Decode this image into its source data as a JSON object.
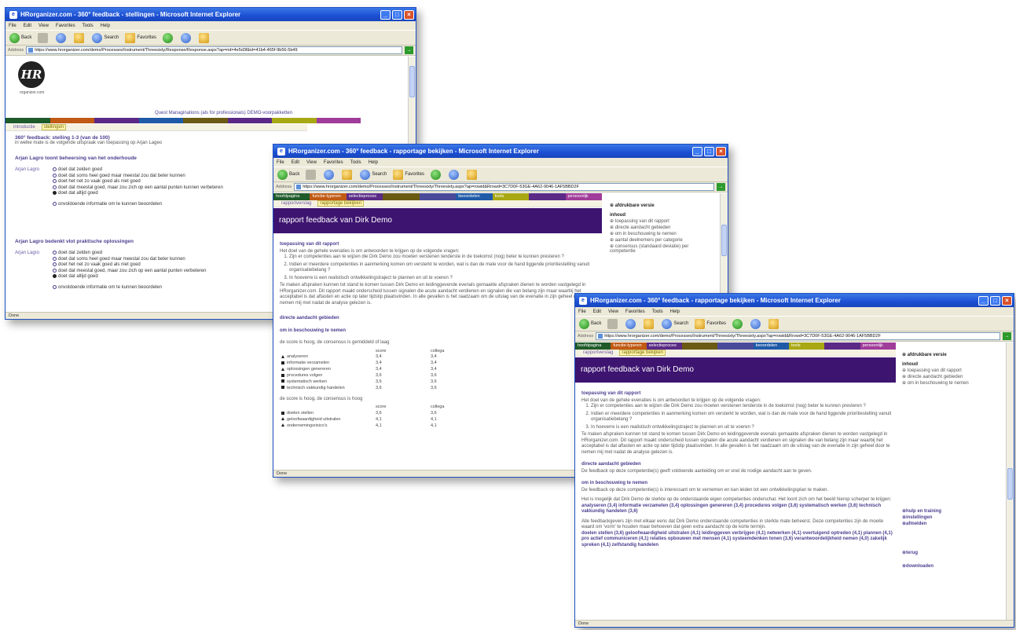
{
  "browser": {
    "menu": [
      "File",
      "Edit",
      "View",
      "Favorites",
      "Tools",
      "Help"
    ],
    "toolbar": {
      "back": "Back",
      "search": "Search",
      "favorites": "Favorites"
    },
    "address_label": "Address",
    "go_label": "Go",
    "status": "Done"
  },
  "window1": {
    "title": "HRorganizer.com - 360° feedback - stellingen - Microsoft Internet Explorer",
    "url": "https://www.hrorganizer.com/demo/Processes/Instrument/Threesixty/Response/Response.aspx?ap=rid=4e5d3f&id=41b4-465f-9b56-5b49",
    "logo_text": "HR",
    "logo_sub": "organizer.com",
    "tagline": "Quest Managinations (als for professionals) DEMO-voorpakketten",
    "colors": [
      "#1f5a2a",
      "#c05a14",
      "#5a2a86",
      "#1f5aa8",
      "#6b5a14",
      "#5a2a86",
      "#a8a814",
      "#a03c9a"
    ],
    "subtabs": [
      "introductie",
      "stellingen"
    ],
    "title_line": "360° feedback: stelling 1-3 (van de 100)",
    "subtitle_line": "in welke mate is de volgende uitspraak van toepassing op Arjan Lageo",
    "blocks": [
      {
        "heading": "Arjan Lagro toont beheersing van het onderhoude",
        "who": "Arjan Lagro",
        "options": [
          "doet dat zelden goed",
          "doet dat soms heel goed maar meestal zou dat beter kunnen",
          "doet het net zo vaak goed als niet goed",
          "doet dat meestal goed, maar zou zich op een aantal punten kunnen verbeteren",
          "doet dat altijd goed"
        ],
        "selected": 4,
        "more": "onvoldoende informatie om te kunnen beoordelen"
      },
      {
        "heading": "Arjan Lagro bedenkt vlot praktische oplossingen",
        "who": "Arjan Lagro",
        "options": [
          "doet dat zelden goed",
          "doet dat soms heel goed maar meestal zou dat beter kunnen",
          "doet het net zo vaak goed als niet goed",
          "doet dat meestal goed, maar zou zich op een aantal punten verbeteren",
          "doet dat altijd goed"
        ],
        "selected": 4,
        "more": "onvoldoende informatie om te kunnen beoordelen"
      }
    ]
  },
  "window2": {
    "title": "HRorganizer.com - 360° feedback - rapportage bekijken - Microsoft Internet Explorer",
    "url": "https://www.hrorganizer.com/demo/Processes/Instrument/Threesixty/Threesixty.aspx?ap=rowid&Rrowd=3C7D0F-53GE-4A62-9046-1AF5BBD2F",
    "navtabs": [
      "hoofdpagina",
      "functie-typeren",
      "selectieproces",
      "",
      "",
      "beoordelen",
      "tools",
      "",
      "persoonlijk"
    ],
    "navcolors": [
      "#1f5a2a",
      "#c05a14",
      "#5a2a86",
      "#6b5a14",
      "#4a4a9a",
      "#1f5aa8",
      "#a8a814",
      "#5a2a86",
      "#a03c9a"
    ],
    "subtabs": [
      "rapportverslag",
      "rapportage bekijken"
    ],
    "banner": "rapport feedback van Dirk Demo",
    "side_title": "afdrukbare versie",
    "side_heading": "inhoud",
    "side_items": [
      "toepassing van dit rapport",
      "directe aandacht gebieden",
      "om in beschouwing te nemen",
      "aantal deelnemers per categorie",
      "consensus (standaard deviatie) per competentie"
    ],
    "h_intro": "toepassing van dit rapport",
    "intro": "Het doel van de gehele evenaties is om antwoorden te krijgen op de volgende vragen:",
    "questions": [
      "Zijn er competenties aan te wijzen die Dirk Demo zou moeten verstenen tenderste in de toekomst (nog) beter te kunnen presteren ?",
      "Indien er meerdere competenties in aanmerking komen om versterkt te worden, wat is dan de mate voor de hand liggende prioritiestelling vanuit organisatiebelang ?",
      "In hoeverre is een realistisch ontwikkelingstraject te plannen en uit te voeren ?"
    ],
    "para": "Te maken afspraken kunnen tot stand te komen tussen Dirk Demo en leidinggevende evenals gemaakte afspraken dienen te worden vastgelegd in HRorganizer.com. Dit rapport maakt onderscheid tussen signalen die acute aandacht verdienen en signalen die van belang zijn maar waarbij het acceptabel is dat aftasten en actie op later tijdstip plaatsvinden. In alle gevallen is het raadzaam om de uitslag van de evenatie in zijn geheel door te nemen mij met nadat de analyse gelezen is.",
    "h_direct": "directe aandacht gebieden",
    "h_consider": "om in beschouwing te nemen",
    "table1_caption": "de score is hoog, de consensus is gemiddeld of laag",
    "table_cols": [
      "",
      "score",
      "collega"
    ],
    "table1": [
      [
        "analyseren",
        "3,4",
        "3,4"
      ],
      [
        "informatie verzamelen",
        "3,4",
        "3,4"
      ],
      [
        "oplossingen genereren",
        "3,4",
        "3,4"
      ],
      [
        "procedures volgen",
        "3,6",
        "3,6"
      ],
      [
        "systematisch werken",
        "3,6",
        "3,6"
      ],
      [
        "technisch vakkundig handelen",
        "3,6",
        "3,6"
      ]
    ],
    "table2_caption": "de score is hoog, de consensus is hoog",
    "table2": [
      [
        "doelen stellen",
        "3,6",
        "3,6"
      ],
      [
        "geloofwaardigheid uitstralen",
        "4,1",
        "4,1"
      ],
      [
        "ondernemingsrisico's",
        "4,1",
        "4,1"
      ]
    ]
  },
  "window3": {
    "title": "HRorganizer.com - 360° feedback - rapportage bekijken - Microsoft Internet Explorer",
    "url": "https://www.hrorganizer.com/demo/Processes/Instrument/Threesixty/Threesixty.aspx?ap=rowid&Rrowd=3C7D0F-53GE-4A62-9046-1AF5BBD2F",
    "subtabs": [
      "rapportverslag",
      "rapportage bekijken"
    ],
    "banner": "rapport feedback van Dirk Demo",
    "side_title": "afdrukbare versie",
    "side_heading": "inhoud",
    "side_items": [
      "toepassing van dit rapport",
      "directe aandacht gebieden",
      "om in beschouwing te nemen"
    ],
    "side_links": [
      "hulp en training",
      "instellingen",
      "afmelden"
    ],
    "side_links2": [
      "terug",
      "downloaden"
    ],
    "h_intro": "toepassing van dit rapport",
    "intro": "Het doel van de gehele evenaties is om antwoorden te krijgen op de volgende vragen:",
    "questions": [
      "Zijn er competenties aan te wijzen die Dirk Demo zou moeten verstenen tenderste in de toekomst (nog) beter te kunnen presteren ?",
      "Indien er meerdere competenties in aanmerking komen om versterkt te worden, wat is dan de mate voor de hand liggende prioritiestelling vanuit organisatiebelang ?",
      "In hoeverre is een realistisch ontwikkelingstraject te plannen en uit te voeren ?"
    ],
    "para": "Te maken afspraken kunnen tot stand te komen tussen Dirk Demo en leidinggevende evenals gemaakte afspraken dienen te worden vastgelegd in HRorganizer.com. Dit rapport maakt onderscheid tussen signalen die acute aandacht verdienen en signalen die van belang zijn maar waarbij het acceptabel is dat aftasten en actie op later tijdstip plaatsvinden. In alle gevallen is het raadzaam om de uitslag van de evenatie in zijn geheel door te nemen mij met nadat de analyse gelezen is.",
    "h_direct": "directe aandacht gebieden",
    "direct_text": "De feedback op deze competentie(s) geeft voldoende aanleiding om er snel de nodige aandacht aan te geven.",
    "h_consider": "om in beschouwing te nemen",
    "consider_text": "De feedback op deze competentie(s) is interessant om te vernemen en kan leiden tot een ontwikkelingsplan te maken.",
    "consider_text2": "Het is mogelijk dat Dirk Demo de sterkte op de onderstaande eigen competenties onderschat. Het loont zich om het beeld hierop scherper te krijgen:",
    "bold_list1": "analyseren (3,4) informatie verzamelen (3,4) oplossingen genereren (3,4) procedures volgen (3,6) systematisch werken (3,6) technisch vakkundig handelen (3,6)",
    "consider_text3": "Alle feedbackgevers zijn met elkaar eens dat Dirk Demo onderstaande competenties in sterkte mate beheerst. Deze competenties zijn de moeite waard om 'vorm' te houden maar behoeven dat geen extra aandacht op de korte termijn.",
    "bold_list2": "doelen stellen (3,6) geloofwaardigheid uitstralen (4,1) leidinggeven verbrijgen (4,1) netwerken (4,1) overtuigend optreden (4,1) plannen (4,1) pro actief communiceren (4,1) relaties opbouwen met mensen (4,1) systeemdenken tonen (3,6) verantwoordelijkheid nemen (4,0) zakelijk spreken (4,1) zelfstandig handelen"
  }
}
